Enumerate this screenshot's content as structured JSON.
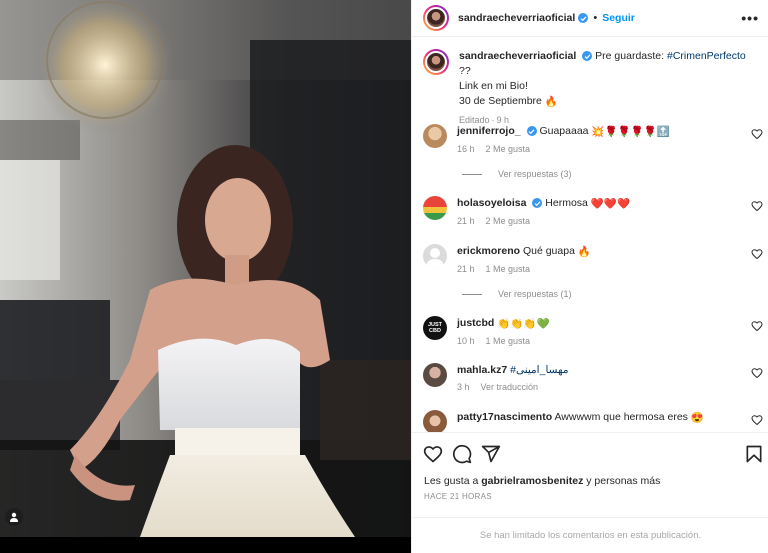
{
  "header": {
    "username": "sandraecheverriaoficial",
    "separator": "•",
    "follow_label": "Seguir",
    "more_label": "•••"
  },
  "caption": {
    "username": "sandraecheverriaoficial",
    "text_before": "Pre guardaste:",
    "hashtag": "#CrimenPerfecto",
    "text_after": "??",
    "line2": "Link en mi Bio!",
    "line3": "30 de Septiembre",
    "line3_emoji": "🔥",
    "edited": "Editado",
    "dot": "·",
    "time": "9 h"
  },
  "comments": [
    {
      "username": "jenniferrojo_",
      "verified": true,
      "text": "Guapaaaa",
      "emojis": "💥🌹🌹🌹🌹🔝",
      "time": "16 h",
      "likes": "2 Me gusta",
      "replies": "Ver respuestas (3)"
    },
    {
      "username": "holasoyeloisa",
      "verified": true,
      "text": "Hermosa",
      "emojis": "❤️❤️❤️",
      "time": "21 h",
      "likes": "2 Me gusta"
    },
    {
      "username": "erickmoreno",
      "verified": false,
      "text": "Qué guapa",
      "emojis": "🔥",
      "time": "21 h",
      "likes": "1 Me gusta",
      "replies": "Ver respuestas (1)"
    },
    {
      "username": "justcbd",
      "verified": false,
      "text": "",
      "emojis": "👏👏👏💚",
      "time": "10 h",
      "likes": "1 Me gusta",
      "avatar_text": "JUST CBD"
    },
    {
      "username": "mahla.kz7",
      "verified": false,
      "text": "#مهسا_امینی",
      "emojis": "",
      "time": "3 h",
      "extra": "Ver traducción"
    },
    {
      "username": "patty17nascimento",
      "verified": false,
      "text": "Awwwwm que hermosa eres",
      "emojis": "😍",
      "time": "",
      "likes": ""
    }
  ],
  "actions": {
    "likes_prefix": "Les gusta a",
    "likes_user": "gabrielramosbenitez",
    "likes_suffix": "y personas más",
    "time_ago": "HACE 21 HORAS"
  },
  "footer": {
    "limited_text": "Se han limitado los comentarios en esta publicación."
  },
  "colors": {
    "accent": "#0095f6",
    "verified": "#3897f0",
    "muted": "#8e8e8e",
    "heart_red": "#ed4956"
  },
  "icons": [
    "heart-icon",
    "comment-icon",
    "share-icon",
    "bookmark-icon",
    "more-icon",
    "user-tag-icon",
    "verified-badge-icon"
  ]
}
